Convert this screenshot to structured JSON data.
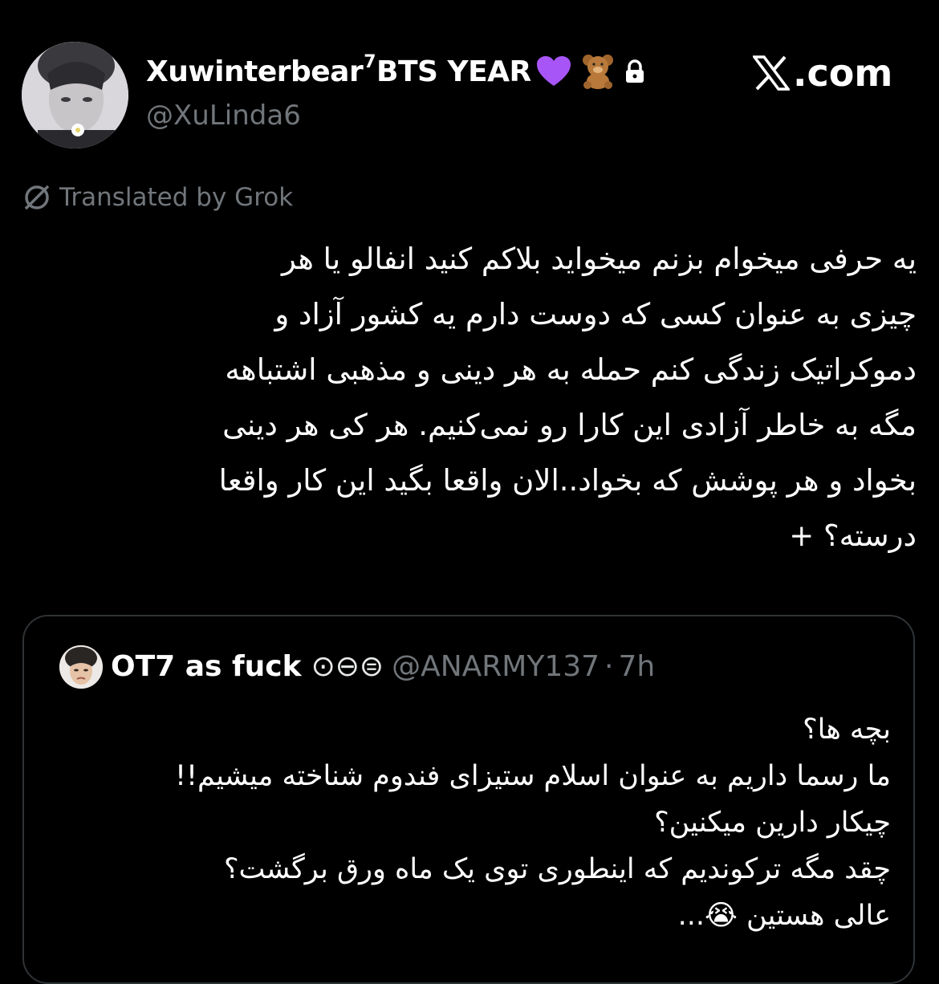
{
  "header": {
    "display_name": "Xuwinterbear",
    "display_name_sup": "7",
    "display_name_suffix": "BTS YEAR",
    "emojis": [
      "purple-heart",
      "teddy-bear"
    ],
    "lock_icon": "lock-icon",
    "handle": "@XuLinda6",
    "site_label": ".com"
  },
  "translation": {
    "label": "Translated by Grok",
    "icon": "grok-icon"
  },
  "tweet": {
    "lines": [
      "یه حرفی میخوام بزنم میخواید بلاکم کنید انفالو یا هر",
      "چیزی به عنوان کسی که دوست دارم یه کشور آزاد و",
      "دموکراتیک زندگی کنم حمله به هر دینی و مذهبی اشتباهه",
      "مگه به خاطر آزادی این کارا رو نمی‌کنیم. هر کی هر دینی",
      "بخواد و هر پوشش که بخواد..الان واقعا بگید این کار واقعا",
      "درسته؟ +"
    ]
  },
  "quote": {
    "name": "OT7 as fuck",
    "badges": "⊙⊖⊜",
    "handle": "@ANARMY137",
    "separator": "·",
    "time": "7h",
    "lines": [
      "بچه ها؟",
      "ما رسما داریم به عنوان اسلام ستیزای فندوم شناخته میشیم!!",
      "چیکار دارین میکنین؟",
      "چقد مگه ترکوندیم که اینطوری توی یک ماه ورق برگشت؟",
      "عالی هستین 😭..."
    ]
  },
  "colors": {
    "background": "#000000",
    "text_primary": "#ffffff",
    "text_secondary": "#71767b",
    "border": "#2f3336",
    "heart": "#a855f7"
  }
}
